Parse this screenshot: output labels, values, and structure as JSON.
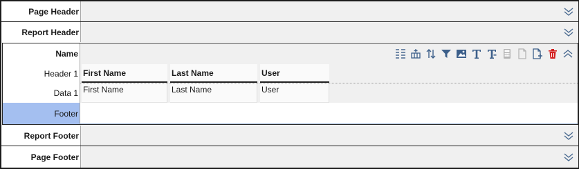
{
  "bands": {
    "page_header": "Page Header",
    "report_header": "Report Header",
    "report_footer": "Report Footer",
    "page_footer": "Page Footer"
  },
  "group": {
    "name_label": "Name",
    "header_label": "Header 1",
    "data_label": "Data 1",
    "footer_label": "Footer",
    "toolbar_icons": [
      "columns-icon",
      "insert-row-icon",
      "sort-icon",
      "filter-icon",
      "image-icon",
      "text-icon",
      "text-alt-icon",
      "calculator-icon",
      "page-icon",
      "page-add-icon",
      "delete-icon",
      "collapse-icon"
    ]
  },
  "table": {
    "headers": [
      "First Name",
      "Last Name",
      "User"
    ],
    "data": [
      "First Name",
      "Last Name",
      "User"
    ]
  },
  "colors": {
    "footer_selected": "#a4bff0",
    "delete": "#d42020",
    "icon": "#3c5f8a"
  }
}
